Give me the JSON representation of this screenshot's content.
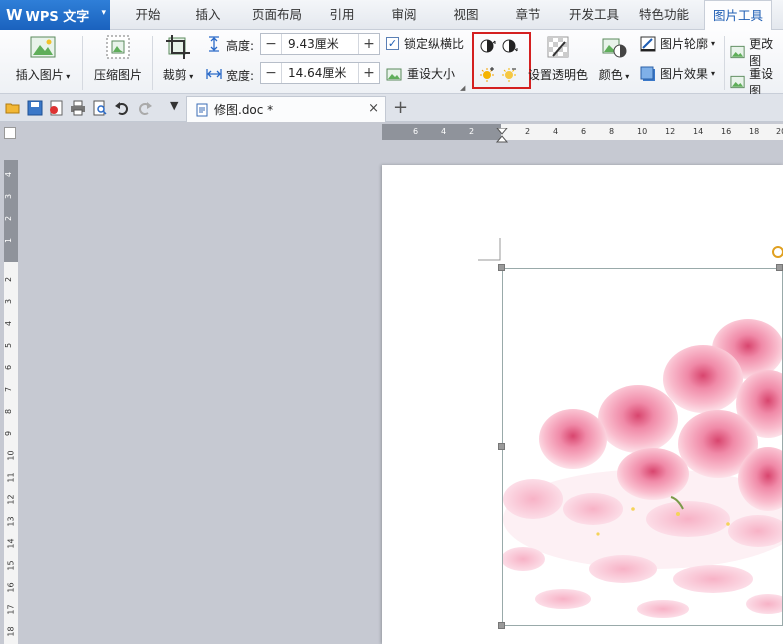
{
  "app": {
    "name": "WPS 文字",
    "logo": "W"
  },
  "menu_tabs": [
    {
      "label": "开始"
    },
    {
      "label": "插入"
    },
    {
      "label": "页面布局"
    },
    {
      "label": "引用"
    },
    {
      "label": "审阅"
    },
    {
      "label": "视图"
    },
    {
      "label": "章节"
    },
    {
      "label": "开发工具"
    },
    {
      "label": "特色功能"
    },
    {
      "label": "图片工具"
    }
  ],
  "ribbon": {
    "insert_picture": "插入图片",
    "compress_picture": "压缩图片",
    "crop": "裁剪",
    "height_label": "高度:",
    "height_value": "9.43厘米",
    "width_label": "宽度:",
    "width_value": "14.64厘米",
    "lock_ratio": "锁定纵横比",
    "reset_size": "重设大小",
    "set_transparent": "设置透明色",
    "color": "颜色",
    "picture_outline": "图片轮廓",
    "picture_effect": "图片效果",
    "change_picture": "更改图",
    "reset_picture": "重设图",
    "minus": "−",
    "plus": "+"
  },
  "document_tab": {
    "title": "修图.doc *",
    "close": "×",
    "new": "+"
  },
  "ruler": {
    "h_ticks": [
      "6",
      "4",
      "2",
      "2",
      "2",
      "4",
      "6",
      "8",
      "10",
      "12",
      "14",
      "16",
      "18",
      "20"
    ],
    "v_ticks": [
      "4",
      "3",
      "2",
      "1",
      "1",
      "2",
      "3",
      "4",
      "5",
      "6",
      "7",
      "8",
      "9",
      "10",
      "11",
      "12",
      "13",
      "14",
      "15",
      "16",
      "17",
      "18"
    ]
  },
  "colors": {
    "accent": "#1f5eb4",
    "highlight_box": "#d42020",
    "workspace": "#c6c9d2"
  }
}
